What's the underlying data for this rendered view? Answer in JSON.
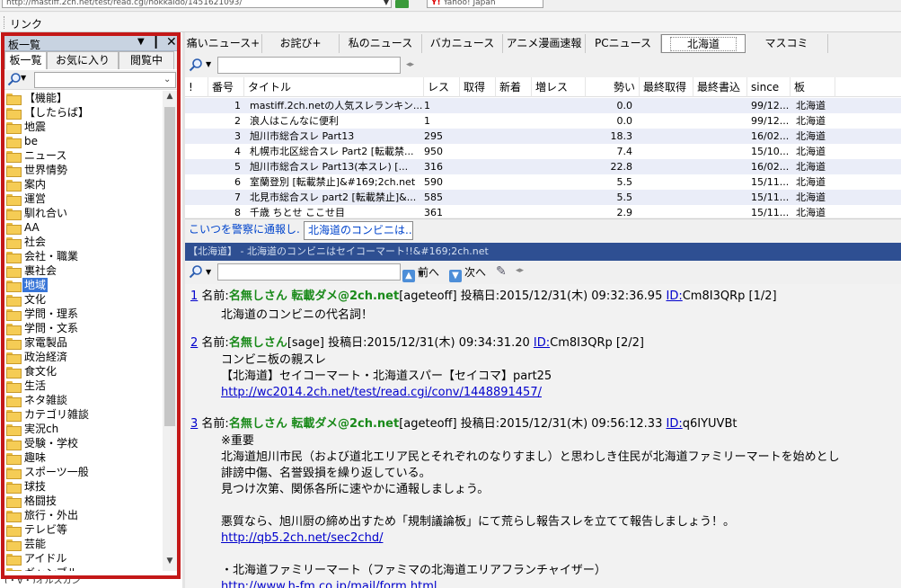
{
  "browser": {
    "address_value": "http://mastiff.2ch.net/test/read.cgi/hokkaido/1451621093/",
    "search_value": "Yahoo! Japan",
    "links_label": "リンク"
  },
  "left_pane": {
    "title": "板一覧",
    "tabs": [
      "板一覧",
      "お気に入り",
      "閲覧中"
    ],
    "search_placeholder": "",
    "items": [
      "【機能】",
      "【したらば】",
      "地震",
      "be",
      "ニュース",
      "世界情勢",
      "案内",
      "運営",
      "馴れ合い",
      "AA",
      "社会",
      "会社・職業",
      "裏社会",
      "地域",
      "文化",
      "学問・理系",
      "学問・文系",
      "家電製品",
      "政治経済",
      "食文化",
      "生活",
      "ネタ雑談",
      "カテゴリ雑談",
      "実況ch",
      "受験・学校",
      "趣味",
      "スポーツ一般",
      "球技",
      "格闘技",
      "旅行・外出",
      "テレビ等",
      "芸能",
      "アイドル",
      "ギャンブル"
    ],
    "selected_item": "地域",
    "bottom_item": "(・∀・)オルスカン"
  },
  "category_tabs": [
    "痛いニュース+",
    "お詫び+",
    "私のニュース",
    "バカニュース",
    "アニメ漫画速報",
    "PCニュース",
    "北海道",
    "マスコミ"
  ],
  "thread_list": {
    "columns": [
      "!",
      "番号",
      "タイトル",
      "レス",
      "取得",
      "新着",
      "増レス",
      "勢い",
      "最終取得",
      "最終書込",
      "since",
      "板"
    ],
    "rows": [
      {
        "num": "1",
        "title": "mastiff.2ch.netの人気スレランキン...",
        "res": "1",
        "ikioi": "0.0",
        "since": "99/12...",
        "board": "北海道"
      },
      {
        "num": "2",
        "title": "浪人はこんなに便利",
        "res": "1",
        "ikioi": "0.0",
        "since": "99/12...",
        "board": "北海道"
      },
      {
        "num": "3",
        "title": "旭川市総合スレ Part13",
        "res": "295",
        "ikioi": "18.3",
        "since": "16/02...",
        "board": "北海道"
      },
      {
        "num": "4",
        "title": "札幌市北区総合スレ Part2 [転載禁...",
        "res": "950",
        "ikioi": "7.4",
        "since": "15/10...",
        "board": "北海道"
      },
      {
        "num": "5",
        "title": "旭川市総合スレ Part13(本スレ) [...",
        "res": "316",
        "ikioi": "22.8",
        "since": "16/02...",
        "board": "北海道"
      },
      {
        "num": "6",
        "title": "室蘭登別 [転載禁止]&#169;2ch.net",
        "res": "590",
        "ikioi": "5.5",
        "since": "15/11...",
        "board": "北海道"
      },
      {
        "num": "7",
        "title": "北見市総合スレ part2 [転載禁止]&...",
        "res": "585",
        "ikioi": "5.5",
        "since": "15/11...",
        "board": "北海道"
      },
      {
        "num": "8",
        "title": "千歳 ちとせ ここせ目",
        "res": "361",
        "ikioi": "2.9",
        "since": "15/11...",
        "board": "北海道"
      }
    ]
  },
  "thread_tabs": [
    "こいつを警察に通報し...",
    "北海道のコンビニは..."
  ],
  "viewer": {
    "title": "【北海道】 - 北海道のコンビニはセイコーマート!!&#169;2ch.net",
    "prev_label": "前へ",
    "next_label": "次へ",
    "posts": [
      {
        "num": "1",
        "name_label": "名前:",
        "name": "名無しさん 転載ダメ@2ch.net",
        "mail": "[ageteoff]",
        "date": "投稿日:2015/12/31(木) 09:32:36.95",
        "id_label": "ID:",
        "id": "Cm8I3QRp",
        "count": "[1/2]",
        "lines": [
          "北海道のコンビニの代名詞！"
        ]
      },
      {
        "num": "2",
        "name_label": "名前:",
        "name": "名無しさん",
        "mail": "[sage]",
        "date": "投稿日:2015/12/31(木) 09:34:31.20",
        "id_label": "ID:",
        "id": "Cm8I3QRp",
        "count": "[2/2]",
        "lines": [
          "コンビニ板の親スレ",
          "【北海道】セイコーマート・北海道スパー【セイコマ】part25"
        ],
        "link": "http://wc2014.2ch.net/test/read.cgi/conv/1448891457/"
      },
      {
        "num": "3",
        "name_label": "名前:",
        "name": "名無しさん 転載ダメ@2ch.net",
        "mail": "[ageteoff]",
        "date": "投稿日:2015/12/31(木) 09:56:12.33",
        "id_label": "ID:",
        "id": "q6IYUVBt",
        "count": "",
        "lines": [
          "※重要",
          "北海道旭川市民（および道北エリア民とそれぞれのなりすまし）と思わしき住民が北海道ファミリーマートを始めとし",
          "誹謗中傷、名誉毀損を繰り返している。",
          "見つけ次第、関係各所に速やかに通報しましょう。",
          "",
          "悪質なら、旭川厨の締め出すため「規制議論板」にて荒らし報告スレを立てて報告しましょう！。"
        ],
        "link": "http://qb5.2ch.net/sec2chd/",
        "extra_line": "・北海道ファミリーマート（ファミマの北海道エリアフランチャイザー）",
        "extra_link": "http://www.h-fm.co.jp/mail/form.html"
      }
    ]
  },
  "colors": {
    "highlight_border": "#c41818",
    "viewer_title_bg": "#2e4f92",
    "name_green": "#1a8a1a",
    "link_blue": "#0000cc",
    "selection": "#3875d7"
  }
}
